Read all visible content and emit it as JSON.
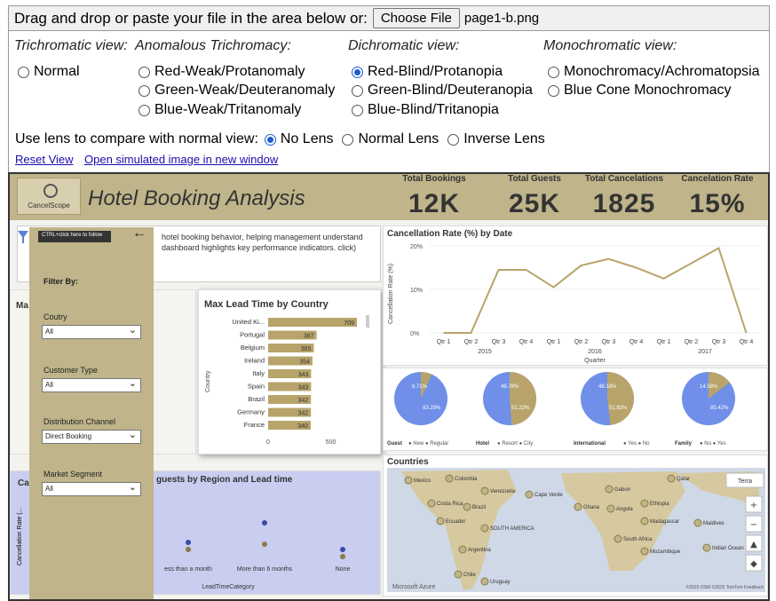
{
  "toolbar": {
    "drag_text": "Drag and drop or paste your file in the area below or:",
    "choose_label": "Choose File",
    "file_name": "page1-b.png"
  },
  "views": {
    "trichromatic": {
      "heading": "Trichromatic view:",
      "options": [
        "Normal"
      ]
    },
    "anomalous": {
      "heading": "Anomalous Trichromacy:",
      "options": [
        "Red-Weak/Protanomaly",
        "Green-Weak/Deuteranomaly",
        "Blue-Weak/Tritanomaly"
      ]
    },
    "dichromatic": {
      "heading": "Dichromatic view:",
      "options": [
        "Red-Blind/Protanopia",
        "Green-Blind/Deuteranopia",
        "Blue-Blind/Tritanopia"
      ]
    },
    "monochromatic": {
      "heading": "Monochromatic view:",
      "options": [
        "Monochromacy/Achromatopsia",
        "Blue Cone Monochromacy"
      ]
    },
    "selected": "Red-Blind/Protanopia"
  },
  "lens": {
    "label": "Use lens to compare with normal view:",
    "options": [
      "No Lens",
      "Normal Lens",
      "Inverse Lens"
    ],
    "selected": "No Lens"
  },
  "links": {
    "reset": "Reset View",
    "open": "Open simulated image in new window"
  },
  "dashboard": {
    "logo_text": "CancelScope",
    "title": "Hotel Booking Analysis",
    "kpis": [
      {
        "label": "Total Bookings",
        "value": "12K"
      },
      {
        "label": "Total Guests",
        "value": "25K"
      },
      {
        "label": "Total Cancelations",
        "value": "1825"
      },
      {
        "label": "Cancelation Rate",
        "value": "15%"
      }
    ],
    "description": "hotel booking behavior, helping management understand dashboard highlights key performance indicators. click)",
    "tooltip": "CTRL+click here to follow",
    "filter": {
      "heading": "Filter By:",
      "fields": [
        {
          "label": "Coutry",
          "value": "All"
        },
        {
          "label": "Customer Type",
          "value": "All"
        },
        {
          "label": "Distribution Channel",
          "value": "Direct Booking"
        },
        {
          "label": "Market Segment",
          "value": "All"
        }
      ]
    },
    "lead_time_title": "Max Lead Time by Country",
    "lead_time_axis": "Country",
    "lead_time_ticks": [
      "0",
      "500"
    ],
    "cancel_title": "Cancellation Rate (%) by Date",
    "cancel_ylabel": "Cancellation Rate (%)",
    "cancel_xlabel": "Quarter",
    "cancel_yticks": [
      "20%",
      "10%",
      "0%"
    ],
    "years": [
      "2015",
      "2016",
      "2017"
    ],
    "guests_title": "guests by Region and Lead time",
    "guests_xlabel": "LeadTimeCategory",
    "guests_ylabel": "Cancellation Rate (...",
    "guests_cats": [
      "ess than a month",
      "More than 6 months",
      "None"
    ],
    "map_title": "Countries",
    "map_labels": [
      "Mexico",
      "Colombia",
      "Venezuela",
      "Cape Verde",
      "Gabon",
      "Costa Rica",
      "Brazil",
      "Ghana",
      "Angola",
      "Ethiopia",
      "Ecuador",
      "SOUTH AMERICA",
      "Madagascar",
      "Maldives",
      "South Africa",
      "Argentina",
      "Mozambique",
      "Indian Ocean",
      "Chile",
      "Uruguay",
      "Qatar",
      "Terra"
    ],
    "map_footer": "©2025 OSM ©2025 TomTom Feedback",
    "map_brand": "Microsoft Azure",
    "pies": [
      {
        "group": "Guest",
        "legend": [
          "New",
          "Regular"
        ],
        "labels": [
          "6.71%",
          "93.29%"
        ],
        "share": 0.0671
      },
      {
        "group": "Hotel",
        "legend": [
          "Resort",
          "City"
        ],
        "labels": [
          "48.78%",
          "51.22%"
        ],
        "share": 0.4878
      },
      {
        "group": "International",
        "legend": [
          "Yes",
          "No"
        ],
        "labels": [
          "48.18%",
          "51.82%"
        ],
        "share": 0.4818
      },
      {
        "group": "Family",
        "legend": [
          "No",
          "Yes"
        ],
        "labels": [
          "14.58%",
          "85.42%"
        ],
        "share": 0.1458
      }
    ],
    "colors": {
      "gold": "#b8a46a",
      "blue": "#6f8fe8",
      "header": "#bfb48a"
    }
  },
  "chart_data": [
    {
      "type": "line",
      "title": "Cancellation Rate (%) by Date",
      "xlabel": "Quarter",
      "ylabel": "Cancellation Rate (%)",
      "x": [
        "Qtr 1 2015",
        "Qtr 2 2015",
        "Qtr 3 2015",
        "Qtr 4 2015",
        "Qtr 1 2016",
        "Qtr 2 2016",
        "Qtr 3 2016",
        "Qtr 4 2016",
        "Qtr 1 2017",
        "Qtr 2 2017",
        "Qtr 3 2017",
        "Qtr 4 2017"
      ],
      "series": [
        {
          "values": [
            0,
            0,
            14.5,
            14.5,
            10.5,
            15.5,
            17,
            15,
            12.5,
            16,
            19.5,
            0
          ]
        }
      ],
      "ylim": [
        0,
        20
      ]
    },
    {
      "type": "bar",
      "title": "Max Lead Time by Country",
      "ylabel": "Country",
      "categories": [
        "United Ki...",
        "Portugal",
        "Belgium",
        "Ireland",
        "Italy",
        "Spain",
        "Brazil",
        "Germany",
        "France"
      ],
      "values": [
        709,
        387,
        365,
        354,
        343,
        343,
        342,
        342,
        340
      ],
      "xlim": [
        0,
        709
      ]
    }
  ]
}
